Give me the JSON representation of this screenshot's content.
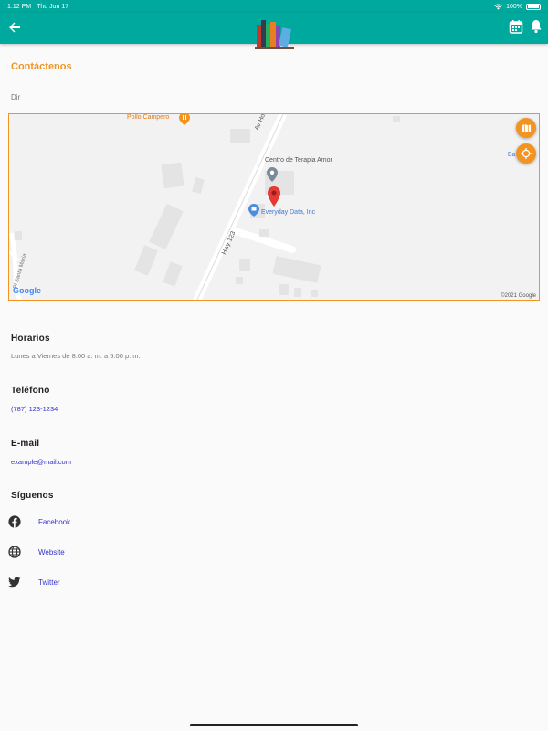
{
  "status_bar": {
    "time": "1:12 PM",
    "date": "Thu Jun 17",
    "battery": "100%"
  },
  "app_bar": {
    "back_icon": "arrow-left-icon",
    "logo": "books-logo",
    "calendar_icon": "calendar-icon",
    "bell_icon": "bell-icon",
    "color": "#00a99d"
  },
  "page": {
    "title": "Contáctenos",
    "dir_label": "Dir",
    "accent": "#f29422"
  },
  "map": {
    "labels": {
      "pollo": "Pollo Campero",
      "av_hostos": "Av Hostos",
      "centro": "Centro de Terapia Amor",
      "everyday": "Everyday Data, Inc",
      "hwy": "Hwy 123",
      "santa_maria": "Pl Santa María",
      "ba": "Ba",
      "google": "Google",
      "copyright": "©2021 Google"
    }
  },
  "hours": {
    "title": "Horarios",
    "value": "Lunes a Viernes de 8:00 a. m. a 5:00 p. m."
  },
  "phone": {
    "title": "Teléfono",
    "value": "(787) 123-1234"
  },
  "email": {
    "title": "E-mail",
    "value": "example@mail.com"
  },
  "social": {
    "title": "Síguenos",
    "items": [
      {
        "label": "Facebook",
        "icon": "facebook-icon"
      },
      {
        "label": "Website",
        "icon": "globe-icon"
      },
      {
        "label": "Twitter",
        "icon": "twitter-icon"
      }
    ]
  }
}
